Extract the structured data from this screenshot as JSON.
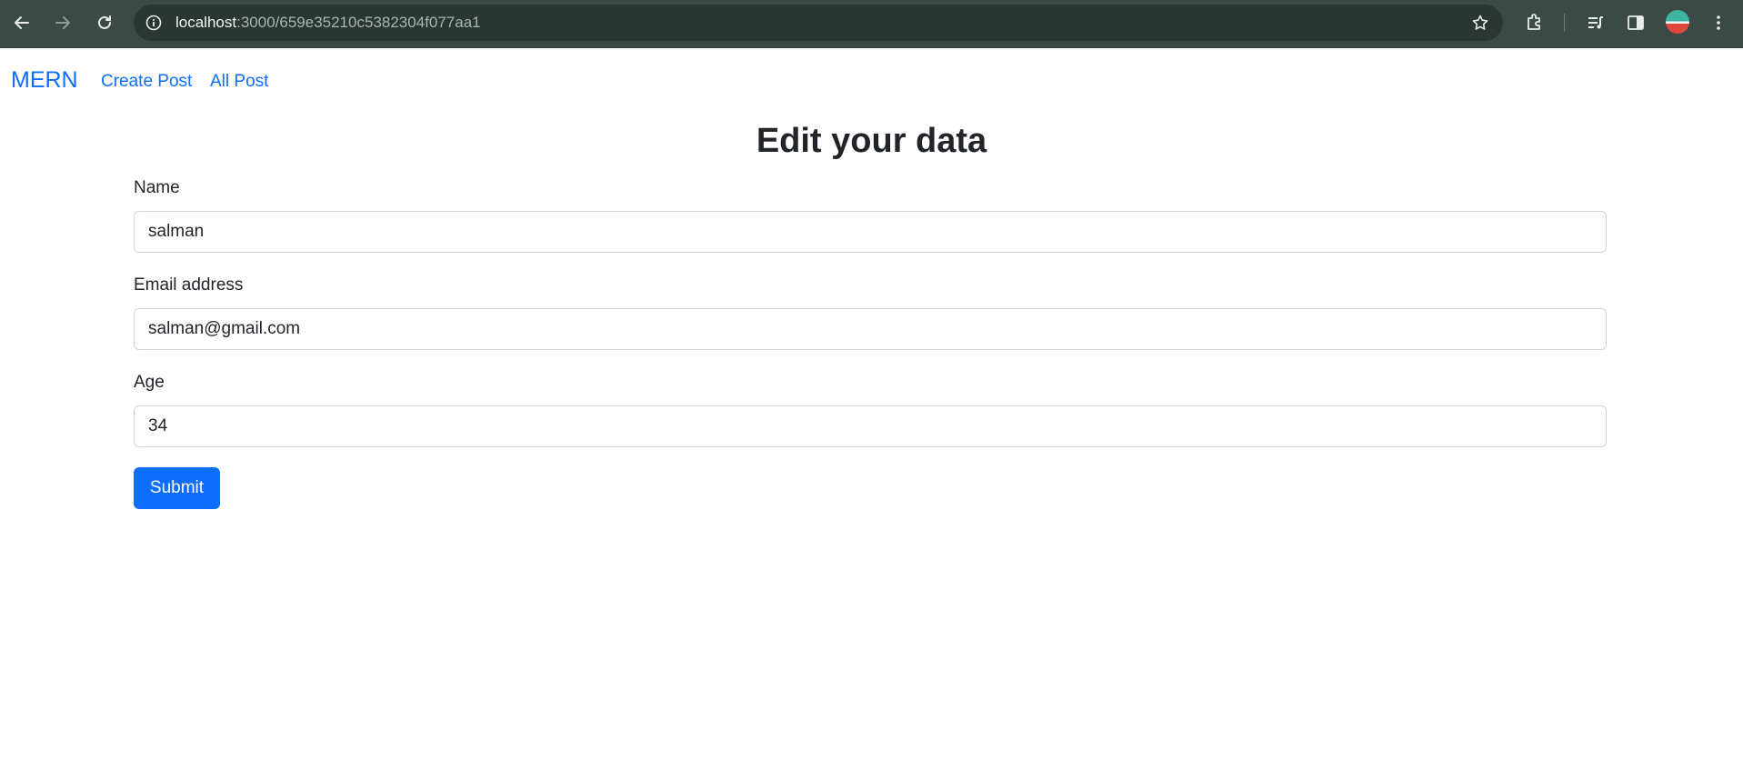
{
  "browser": {
    "url_host": "localhost",
    "url_path": ":3000/659e35210c5382304f077aa1",
    "icons": [
      "back-arrow-icon",
      "forward-arrow-icon",
      "reload-icon",
      "info-icon",
      "star-icon",
      "extensions-icon",
      "media-controls-icon",
      "side-panel-icon",
      "profile-avatar",
      "more-vert-icon"
    ]
  },
  "navbar": {
    "brand": "MERN",
    "links": [
      "Create Post",
      "All Post"
    ]
  },
  "form": {
    "title": "Edit your data",
    "fields": [
      {
        "label": "Name",
        "value": "salman"
      },
      {
        "label": "Email address",
        "value": "salman@gmail.com"
      },
      {
        "label": "Age",
        "value": "34"
      }
    ],
    "submit_label": "Submit"
  },
  "colors": {
    "primary": "#0d6efd",
    "chrome_bg": "#3c4a46",
    "text": "#212529"
  }
}
